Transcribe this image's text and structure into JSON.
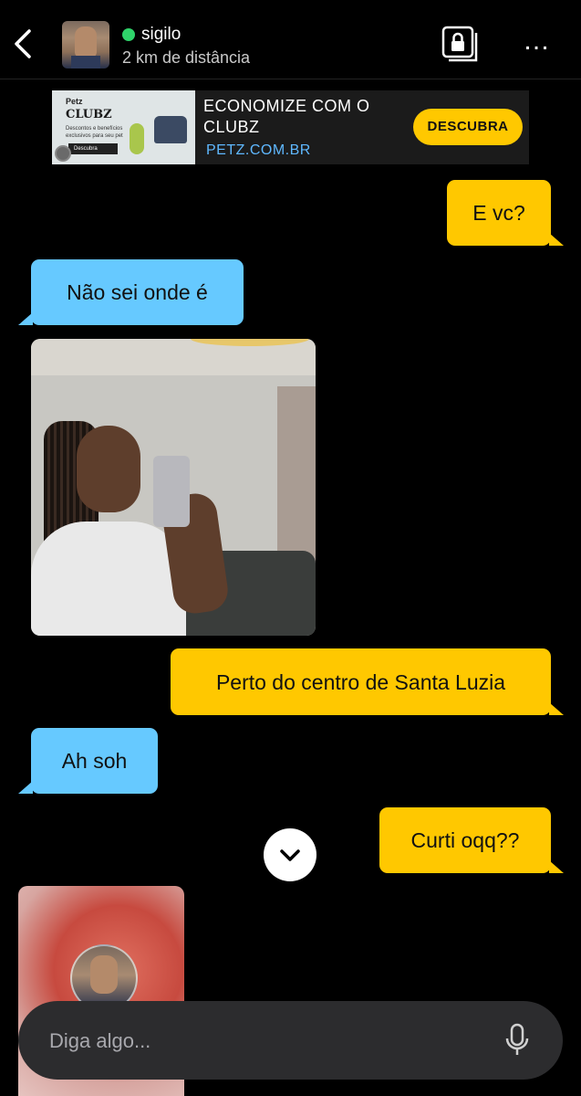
{
  "header": {
    "username": "sigilo",
    "distance": "2 km de distância",
    "online_color": "#2fd36a",
    "back_icon": "chevron-left-icon",
    "album_icon": "private-album-lock-icon",
    "more_icon": "more-dots-icon"
  },
  "ad": {
    "image_brand": "Petz",
    "image_title": "CLUBZ",
    "image_desc": "Descontos e benefícios exclusivos para seu pet",
    "image_button": "Descubra",
    "title": "ECONOMIZE COM O CLUBZ",
    "domain": "PETZ.COM.BR",
    "cta": "DESCUBRA"
  },
  "messages": [
    {
      "side": "out",
      "text": "E vc?"
    },
    {
      "side": "in",
      "text": "Não sei onde é"
    },
    {
      "side": "in",
      "type": "photo",
      "description": "mirror-selfie"
    },
    {
      "side": "out",
      "text": "Perto do centro de Santa Luzia"
    },
    {
      "side": "in",
      "text": "Ah soh"
    },
    {
      "side": "out",
      "text": "Curti oqq??"
    },
    {
      "side": "in",
      "type": "photo",
      "description": "blurred-profile-photo"
    }
  ],
  "composer": {
    "placeholder": "Diga algo...",
    "mic_icon": "microphone-icon"
  },
  "colors": {
    "outgoing_bubble": "#ffc800",
    "incoming_bubble": "#66c9ff",
    "background": "#000000",
    "ad_cta": "#ffc800",
    "ad_domain": "#5fb8ff"
  }
}
